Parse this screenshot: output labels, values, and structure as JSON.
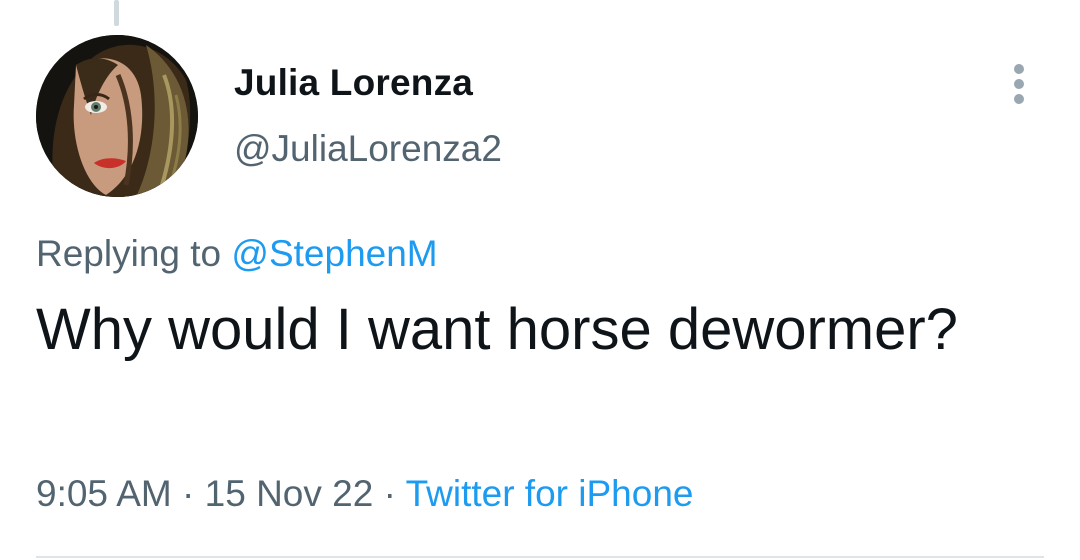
{
  "tweet": {
    "author": {
      "display_name": "Julia Lorenza",
      "handle": "@JuliaLorenza2"
    },
    "reply_context": {
      "prefix": "Replying to",
      "mention": "@StephenM"
    },
    "text": "Why would I want horse dewormer?",
    "meta": {
      "time": "9:05 AM",
      "separator": "·",
      "date": "15 Nov 22",
      "source": "Twitter for iPhone"
    }
  },
  "icons": {
    "more": "more-vertical-icon",
    "avatar": "profile-photo"
  },
  "colors": {
    "text_primary": "#0f1419",
    "text_secondary": "#536471",
    "link": "#1d9bf0",
    "background": "#ffffff"
  }
}
